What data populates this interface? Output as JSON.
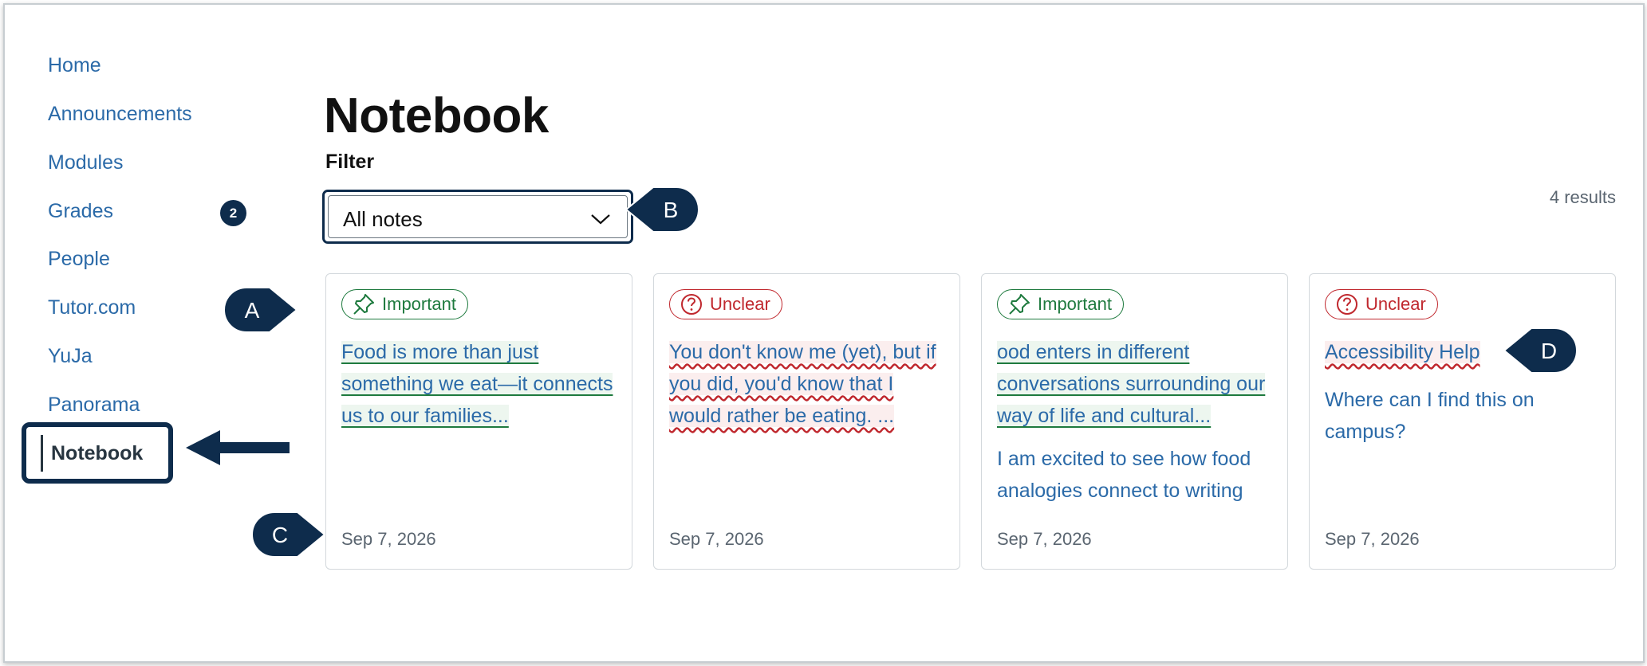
{
  "sidebar": {
    "items": [
      {
        "label": "Home"
      },
      {
        "label": "Announcements"
      },
      {
        "label": "Modules"
      },
      {
        "label": "Grades",
        "badge": "2"
      },
      {
        "label": "People"
      },
      {
        "label": "Tutor.com"
      },
      {
        "label": "YuJa"
      },
      {
        "label": "Panorama"
      },
      {
        "label": "Notebook",
        "active": true
      }
    ]
  },
  "main": {
    "title": "Notebook",
    "filter": {
      "label": "Filter",
      "selected": "All notes"
    },
    "results": "4 results",
    "cards": [
      {
        "tag": "Important",
        "tag_type": "important",
        "tag_icon": "pin-icon",
        "title": "Food is more than just something we eat—it connects us to our families...",
        "body": "",
        "date": "Sep 7, 2026"
      },
      {
        "tag": "Unclear",
        "tag_type": "unclear",
        "tag_icon": "question-circle-icon",
        "title": "You don't know me (yet), but if you did, you'd know that I would rather be eating. ...",
        "body": "",
        "date": "Sep 7, 2026"
      },
      {
        "tag": "Important",
        "tag_type": "important",
        "tag_icon": "pin-icon",
        "title": "ood enters in different conversations surrounding our way of life and cultural...",
        "body": "I am excited to see how food analogies connect to writing",
        "date": "Sep 7, 2026"
      },
      {
        "tag": "Unclear",
        "tag_type": "unclear",
        "tag_icon": "question-circle-icon",
        "title": "Accessibility Help",
        "body": "Where can I find this on campus?",
        "date": "Sep 7, 2026"
      }
    ]
  },
  "callouts": [
    "A",
    "B",
    "C",
    "D"
  ],
  "colors": {
    "navy": "#0e2c4c",
    "link": "#2b6aa8",
    "important": "#1e7a3e",
    "unclear": "#c0282e"
  }
}
